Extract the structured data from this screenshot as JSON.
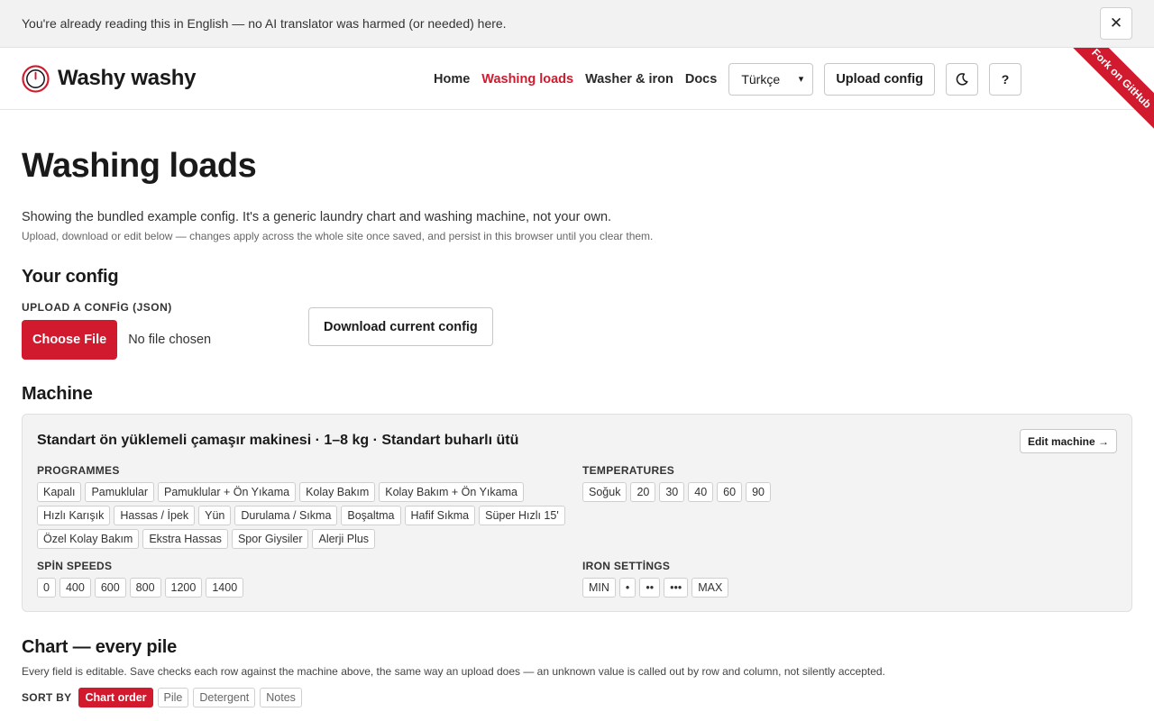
{
  "banner": {
    "text": "You're already reading this in English — no AI translator was harmed (or needed) here.",
    "close_label": "✕"
  },
  "header": {
    "brand": "Washy washy",
    "nav": [
      "Home",
      "Washing loads",
      "Washer & iron",
      "Docs"
    ],
    "active_nav": "Washing loads",
    "language": "Türkçe",
    "upload_config": "Upload config",
    "theme_icon": "moon-icon",
    "help_label": "?",
    "ribbon": "Fork on GitHub"
  },
  "page": {
    "title": "Washing loads",
    "lead": "Showing the bundled example config. It's a generic laundry chart and washing machine, not your own.",
    "sublead": "Upload, download or edit below — changes apply across the whole site once saved, and persist in this browser until you clear them."
  },
  "config": {
    "title": "Your config",
    "upload_label": "UPLOAD A CONFİG (JSON)",
    "choose_file": "Choose File",
    "no_file": "No file chosen",
    "download": "Download current config"
  },
  "machine": {
    "section_title": "Machine",
    "name": "Standart ön yüklemeli çamaşır makinesi · 1–8 kg · Standart buharlı ütü",
    "edit": "Edit machine →",
    "programmes_label": "PROGRAMMES",
    "programmes": [
      "Kapalı",
      "Pamuklular",
      "Pamuklular + Ön Yıkama",
      "Kolay Bakım",
      "Kolay Bakım + Ön Yıkama",
      "Hızlı Karışık",
      "Hassas / İpek",
      "Yün",
      "Durulama / Sıkma",
      "Boşaltma",
      "Hafif Sıkma",
      "Süper Hızlı 15'",
      "Özel Kolay Bakım",
      "Ekstra Hassas",
      "Spor Giysiler",
      "Alerji Plus"
    ],
    "temperatures_label": "TEMPERATURES",
    "temperatures": [
      "Soğuk",
      "20",
      "30",
      "40",
      "60",
      "90"
    ],
    "spin_label": "SPİN SPEEDS",
    "spin_speeds": [
      "0",
      "400",
      "600",
      "800",
      "1200",
      "1400"
    ],
    "iron_label": "IRON SETTİNGS",
    "iron_settings": [
      "MIN",
      "•",
      "••",
      "•••",
      "MAX"
    ]
  },
  "chart": {
    "title": "Chart — every pile",
    "description": "Every field is editable. Save checks each row against the machine above, the same way an upload does — an unknown value is called out by row and column, not silently accepted.",
    "sort_label": "SORT BY",
    "sort_options": [
      "Chart order",
      "Pile",
      "Detergent",
      "Notes"
    ],
    "active_sort": "Chart order"
  },
  "colors": {
    "accent": "#d11a2e",
    "card_bg": "#f3f3f3",
    "banner_bg": "#f2f2f2"
  }
}
